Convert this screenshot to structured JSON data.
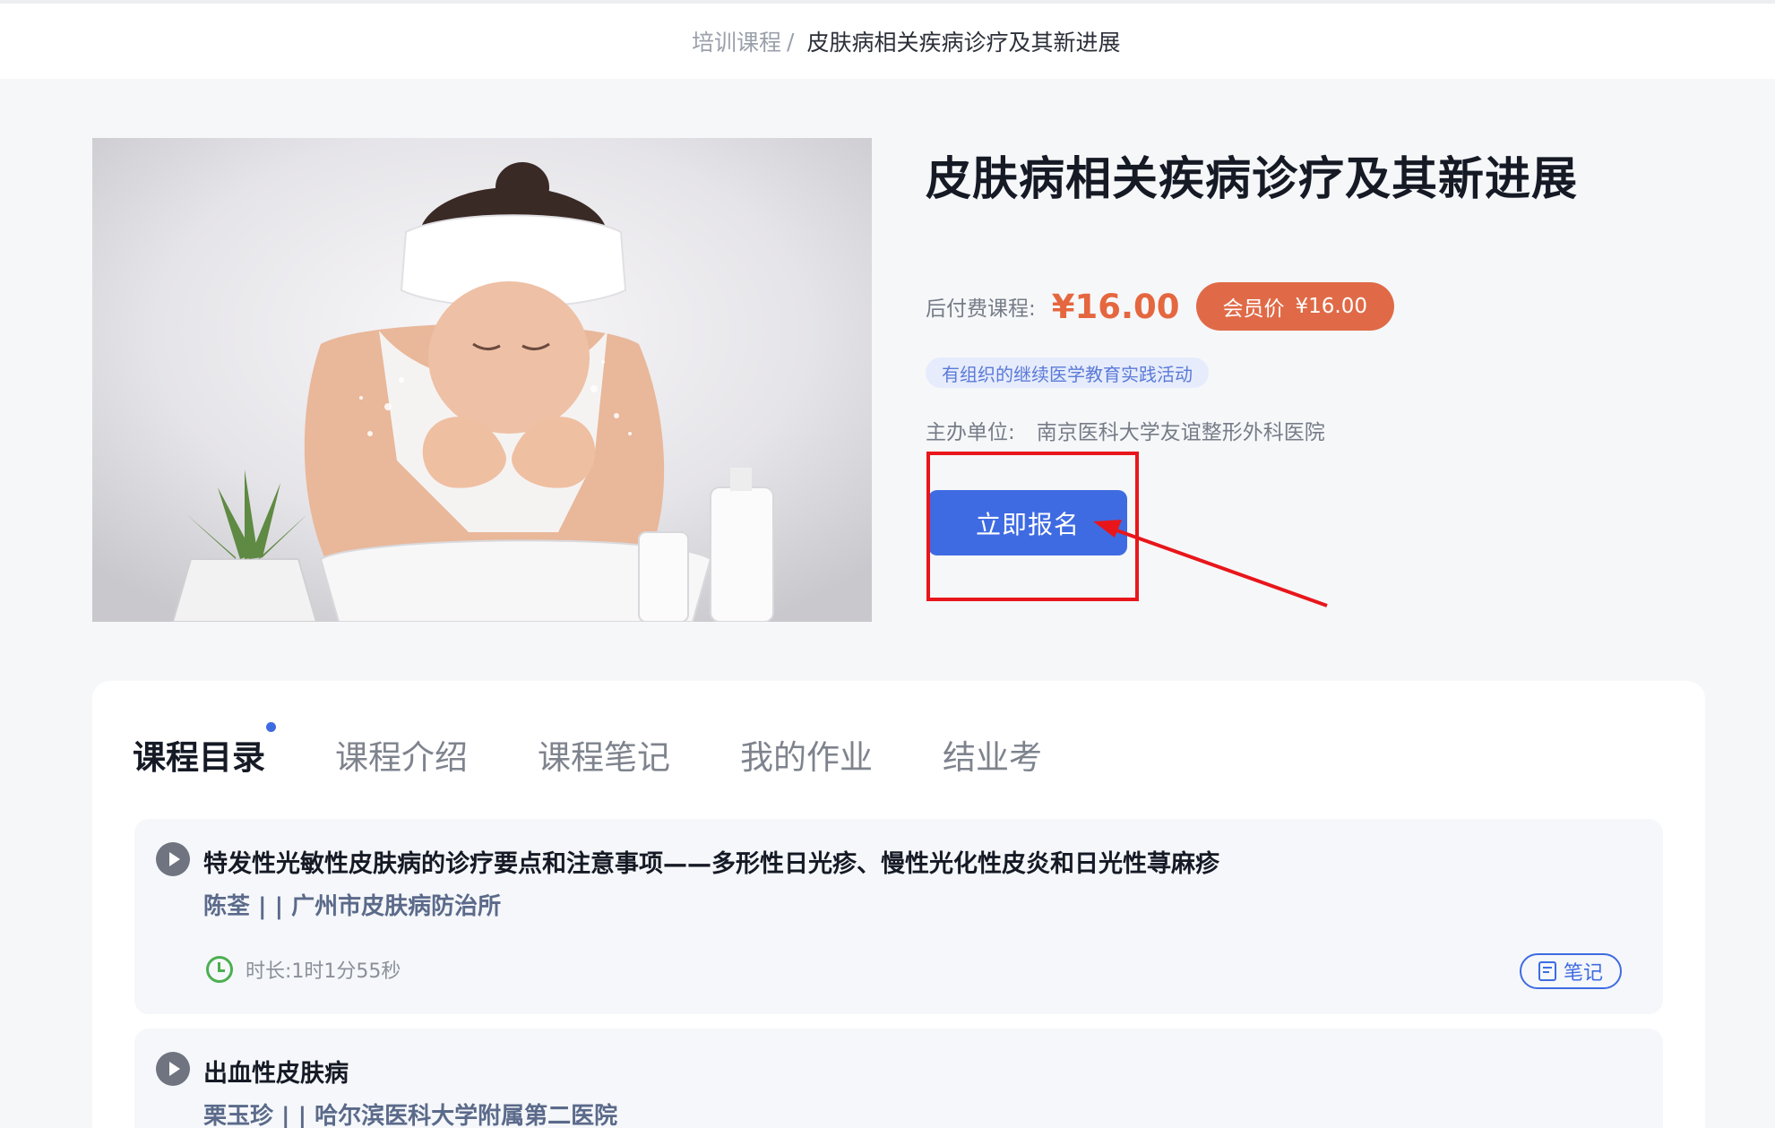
{
  "breadcrumb": {
    "parent": "培训课程",
    "separator": "/",
    "current": "皮肤病相关疾病诊疗及其新进展"
  },
  "course": {
    "title": "皮肤病相关疾病诊疗及其新进展",
    "price_label": "后付费课程:",
    "price": "¥16.00",
    "member_label": "会员价",
    "member_price": "¥16.00",
    "tag": "有组织的继续医学教育实践活动",
    "organizer_label": "主办单位:",
    "organizer": "南京医科大学友谊整形外科医院",
    "enroll_label": "立即报名"
  },
  "tabs": [
    {
      "label": "课程目录",
      "active": true
    },
    {
      "label": "课程介绍",
      "active": false
    },
    {
      "label": "课程笔记",
      "active": false
    },
    {
      "label": "我的作业",
      "active": false
    },
    {
      "label": "结业考",
      "active": false
    }
  ],
  "lessons": [
    {
      "title": "特发性光敏性皮肤病的诊疗要点和注意事项——多形性日光疹、慢性光化性皮炎和日光性荨麻疹",
      "lecturer": "陈荃 | | 广州市皮肤病防治所",
      "duration_label": "时长:",
      "duration": "1时1分55秒",
      "note_label": "笔记"
    },
    {
      "title": "出血性皮肤病",
      "lecturer": "栗玉珍 | | 哈尔滨医科大学附属第二医院"
    }
  ],
  "colors": {
    "primary": "#3f6be2",
    "price": "#e5673f",
    "member_pill": "#e06a47",
    "annotation_red": "#e8161b"
  }
}
